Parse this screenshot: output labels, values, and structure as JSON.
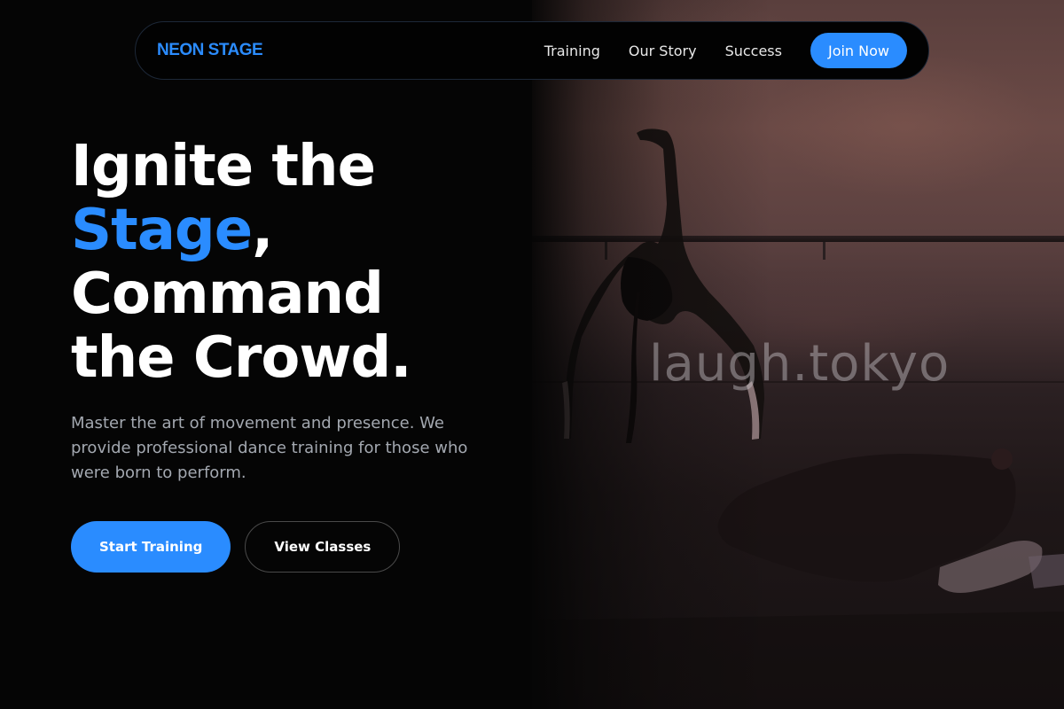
{
  "brand": {
    "name": "NEON STAGE",
    "accent_color": "#2a8cff"
  },
  "nav": {
    "links": [
      {
        "label": "Training"
      },
      {
        "label": "Our Story"
      },
      {
        "label": "Success"
      }
    ],
    "cta_label": "Join Now"
  },
  "hero": {
    "headline_line1": "Ignite the",
    "headline_accent": "Stage",
    "headline_comma": ",",
    "headline_line3": "Command",
    "headline_line4": "the Crowd.",
    "subtitle": "Master the art of movement and presence. We provide professional dance training for those who were born to perform.",
    "primary_cta": "Start Training",
    "secondary_cta": "View Classes"
  },
  "image": {
    "watermark_text": "laugh.tokyo",
    "description_icon": "dancer-photo"
  }
}
